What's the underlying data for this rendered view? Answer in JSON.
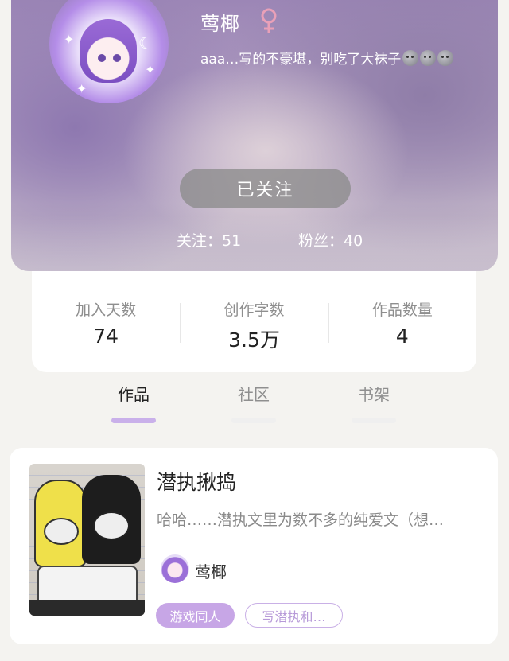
{
  "profile": {
    "nickname": "莺椰",
    "gender_icon": "female-icon",
    "bio": "aaa…写的不豪堪，别吃了大袜子",
    "bio_emojis": [
      "moon-face-icon",
      "moon-face-icon",
      "moon-face-icon"
    ],
    "follow_button_label": "已关注",
    "following_text": "关注：51",
    "followers_text": "粉丝：40",
    "accent_color": "#c9b0ea"
  },
  "stats": [
    {
      "label": "加入天数",
      "value": "74"
    },
    {
      "label": "创作字数",
      "value": "3.5万"
    },
    {
      "label": "作品数量",
      "value": "4"
    }
  ],
  "tabs": [
    {
      "label": "作品",
      "active": true
    },
    {
      "label": "社区",
      "active": false
    },
    {
      "label": "书架",
      "active": false
    }
  ],
  "works": [
    {
      "title": "潜执揪捣",
      "description": "哈哈……潜执文里为数不多的纯爱文（想…",
      "author": "莺椰",
      "tags": [
        "游戏同人",
        "写潜执和…"
      ]
    }
  ]
}
